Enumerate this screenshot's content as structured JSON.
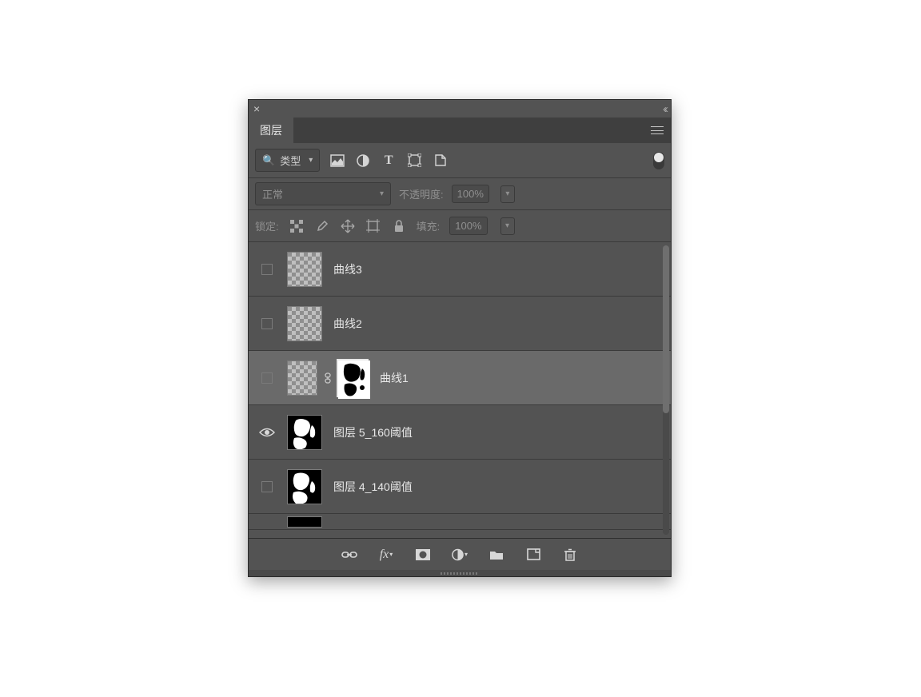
{
  "panel": {
    "tab_label": "图层",
    "filter": {
      "label": "类型",
      "kinds": [
        "image",
        "adjustment",
        "type",
        "shape",
        "smartobject"
      ]
    },
    "blend": {
      "mode_label": "正常",
      "opacity_label": "不透明度:",
      "opacity_value": "100%"
    },
    "lock": {
      "label": "锁定:",
      "fill_label": "填充:",
      "fill_value": "100%"
    },
    "layers": [
      {
        "name": "曲线3",
        "visible": false,
        "selected": false,
        "thumb": "checker",
        "mask": false
      },
      {
        "name": "曲线2",
        "visible": false,
        "selected": false,
        "thumb": "checker",
        "mask": false
      },
      {
        "name": "曲线1",
        "visible": false,
        "selected": true,
        "thumb": "checker",
        "mask": true
      },
      {
        "name": "图层 5_160阈值",
        "visible": true,
        "selected": false,
        "thumb": "image",
        "mask": false
      },
      {
        "name": "图层 4_140阈值",
        "visible": false,
        "selected": false,
        "thumb": "image",
        "mask": false
      }
    ],
    "footer_icons": [
      "link",
      "fx",
      "mask",
      "adjust",
      "group",
      "new",
      "trash"
    ]
  }
}
